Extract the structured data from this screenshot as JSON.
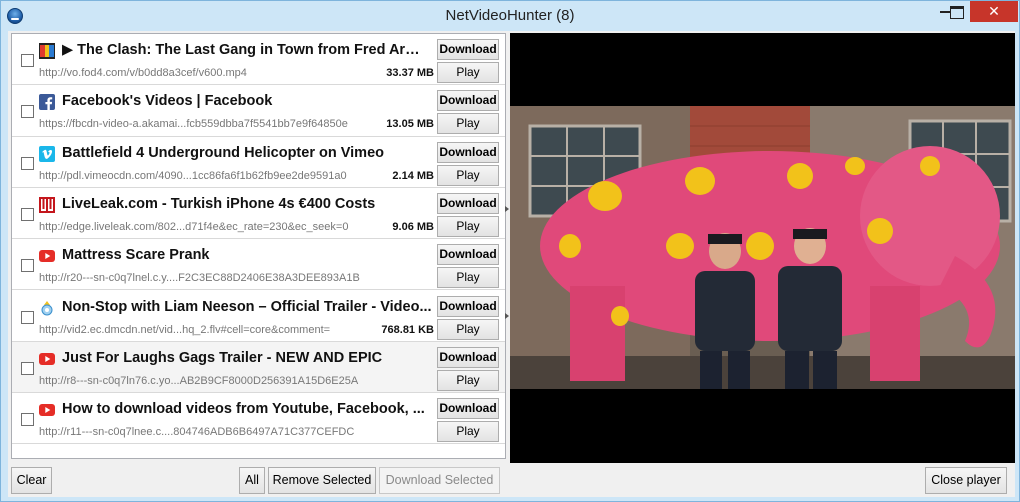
{
  "window": {
    "title": "NetVideoHunter (8)",
    "controls": [
      "minimize-icon",
      "maximize-icon",
      "close-icon"
    ],
    "close_glyph": "✕"
  },
  "videos": [
    {
      "icon": "fod4-icon",
      "title": "▶ The Clash: The Last Gang in Town from Fred Armi...",
      "url": "http://vo.fod4.com/v/b0dd8a3cef/v600.mp4",
      "size": "33.37 MB",
      "download_label": "Download",
      "play_label": "Play"
    },
    {
      "icon": "facebook-icon",
      "title": "Facebook's Videos | Facebook",
      "url": "https://fbcdn-video-a.akamai...fcb559dbba7f5541bb7e9f64850e",
      "size": "13.05 MB",
      "download_label": "Download",
      "play_label": "Play"
    },
    {
      "icon": "vimeo-icon",
      "title": "Battlefield 4 Underground Helicopter on Vimeo",
      "url": "http://pdl.vimeocdn.com/4090...1cc86fa6f1b62fb9ee2de9591a0",
      "size": "2.14 MB",
      "download_label": "Download",
      "play_label": "Play"
    },
    {
      "icon": "liveleak-icon",
      "title": "LiveLeak.com - Turkish iPhone 4s €400 Costs",
      "url": "http://edge.liveleak.com/802...d71f4e&ec_rate=230&ec_seek=0",
      "size": "9.06 MB",
      "download_label": "Download",
      "play_label": "Play"
    },
    {
      "icon": "youtube-icon",
      "title": "Mattress Scare Prank",
      "url": "http://r20---sn-c0q7lnel.c.y....F2C3EC88D2406E38A3DEE893A1B",
      "size": "",
      "download_label": "Download",
      "play_label": "Play"
    },
    {
      "icon": "dailymotion-icon",
      "title": "Non-Stop with Liam Neeson – Official Trailer - Video...",
      "url": "http://vid2.ec.dmcdn.net/vid...hq_2.flv#cell=core&comment=",
      "size": "768.81 KB",
      "download_label": "Download",
      "play_label": "Play"
    },
    {
      "icon": "youtube-icon",
      "title": "Just For Laughs Gags Trailer - NEW AND EPIC",
      "url": "http://r8---sn-c0q7ln76.c.yo...AB2B9CF8000D256391A15D6E25A",
      "size": "",
      "download_label": "Download",
      "play_label": "Play"
    },
    {
      "icon": "youtube-icon",
      "title": "How to download videos from Youtube, Facebook, ...",
      "url": "http://r11---sn-c0q7lnee.c....804746ADB6B6497A71C377CEFDC",
      "size": "",
      "download_label": "Download",
      "play_label": "Play"
    }
  ],
  "toolbar": {
    "clear_label": "Clear",
    "all_label": "All",
    "remove_selected_label": "Remove Selected",
    "download_selected_label": "Download Selected",
    "close_player_label": "Close player"
  },
  "colors": {
    "title_bar": "#cde6f7",
    "close_button": "#c7352a",
    "facebook": "#3b5998",
    "vimeo": "#1ab7ea",
    "youtube": "#e52d27",
    "liveleak": "#c4161c",
    "elephant": "#e0497a",
    "spots": "#f2c21a"
  }
}
